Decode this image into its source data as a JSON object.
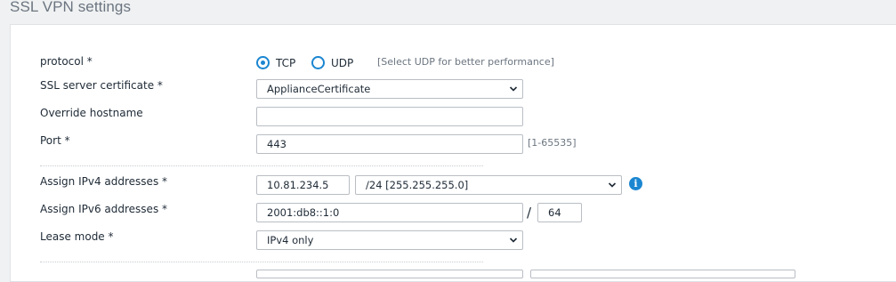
{
  "page": {
    "title": "SSL VPN settings"
  },
  "protocol": {
    "label": "protocol *",
    "options": [
      {
        "label": "TCP",
        "checked": true
      },
      {
        "label": "UDP",
        "checked": false
      }
    ],
    "hint": "[Select UDP for better performance]"
  },
  "certificate": {
    "label": "SSL server certificate *",
    "value": "ApplianceCertificate"
  },
  "override_hostname": {
    "label": "Override hostname",
    "value": ""
  },
  "port": {
    "label": "Port *",
    "value": "443",
    "hint": "[1-65535]"
  },
  "ipv4": {
    "label": "Assign IPv4 addresses *",
    "address": "10.81.234.5",
    "netmask": "/24 [255.255.255.0]",
    "info_icon": "info-icon"
  },
  "ipv6": {
    "label": "Assign IPv6 addresses *",
    "address": "2001:db8::1:0",
    "separator": "/",
    "prefix": "64"
  },
  "lease_mode": {
    "label": "Lease mode *",
    "value": "IPv4 only"
  },
  "colors": {
    "accent": "#1b86d1",
    "border": "#b9bec4",
    "hint": "#6b7580"
  }
}
